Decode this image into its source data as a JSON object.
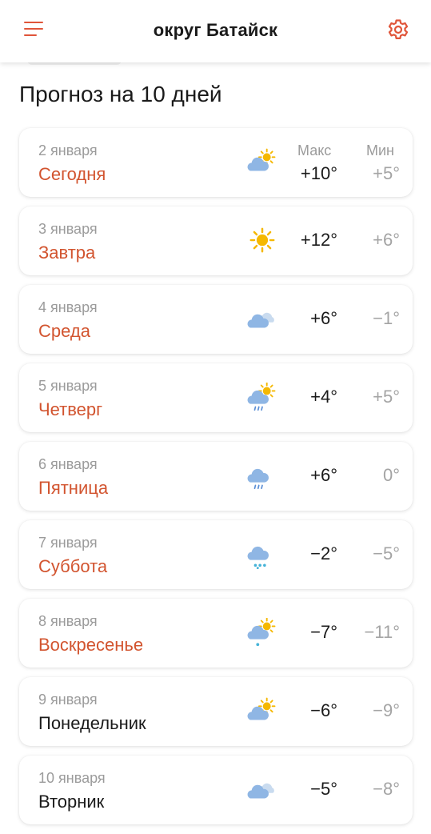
{
  "header": {
    "title": "округ Батайск",
    "accent_color": "#e0553a",
    "menu_icon": "hamburger-menu-icon",
    "settings_icon": "gear-icon"
  },
  "page_title": "Прогноз на 10 дней",
  "columns": {
    "max_label": "Макс",
    "min_label": "Мин"
  },
  "days": [
    {
      "date": "2 января",
      "name": "Сегодня",
      "icon": "partly-cloudy-icon",
      "max": "+10°",
      "min": "+5°",
      "highlight": true
    },
    {
      "date": "3 января",
      "name": "Завтра",
      "icon": "sun-icon",
      "max": "+12°",
      "min": "+6°",
      "highlight": true
    },
    {
      "date": "4 января",
      "name": "Среда",
      "icon": "cloudy-icon",
      "max": "+6°",
      "min": "−1°",
      "highlight": true
    },
    {
      "date": "5 января",
      "name": "Четверг",
      "icon": "sun-cloud-rain-icon",
      "max": "+4°",
      "min": "+5°",
      "highlight": true
    },
    {
      "date": "6 января",
      "name": "Пятница",
      "icon": "cloud-rain-icon",
      "max": "+6°",
      "min": "0°",
      "highlight": true
    },
    {
      "date": "7 января",
      "name": "Суббота",
      "icon": "cloud-snow-icon",
      "max": "−2°",
      "min": "−5°",
      "highlight": true
    },
    {
      "date": "8 января",
      "name": "Воскресенье",
      "icon": "sun-cloud-snow-icon",
      "max": "−7°",
      "min": "−11°",
      "highlight": true
    },
    {
      "date": "9 января",
      "name": "Понедельник",
      "icon": "partly-cloudy-icon",
      "max": "−6°",
      "min": "−9°",
      "highlight": false
    },
    {
      "date": "10 января",
      "name": "Вторник",
      "icon": "cloudy-icon",
      "max": "−5°",
      "min": "−8°",
      "highlight": false
    }
  ]
}
